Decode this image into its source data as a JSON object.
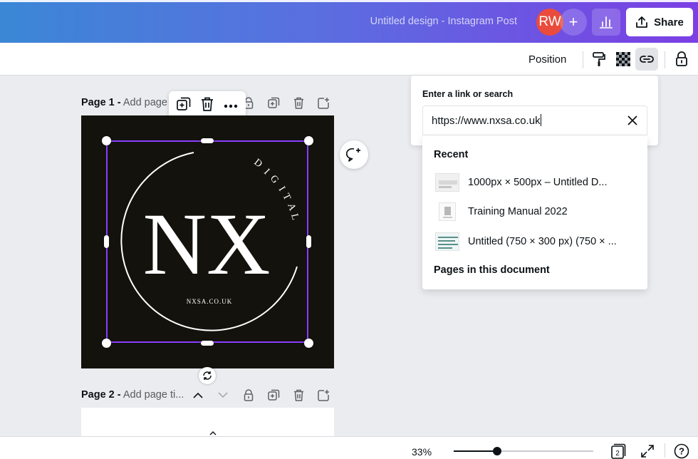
{
  "header": {
    "doc_title": "Untitled design - Instagram Post",
    "avatar_initials": "RW",
    "add_people": "+",
    "share_label": "Share"
  },
  "toolbar": {
    "position_label": "Position"
  },
  "pages": [
    {
      "number_label": "Page 1 -",
      "title_placeholder": "Add page t"
    },
    {
      "number_label": "Page 2 -",
      "title_placeholder": "Add page ti..."
    }
  ],
  "design": {
    "word_digital": "DIGITAL",
    "monogram": "NX",
    "website": "NXSA.CO.UK"
  },
  "link_panel": {
    "label": "Enter a link or search",
    "input_value": "https://www.nxsa.co.uk",
    "recent_heading": "Recent",
    "recent_items": [
      {
        "title": "1000px × 500px – Untitled D..."
      },
      {
        "title": "Training Manual 2022"
      },
      {
        "title": "Untitled (750 × 300 px) (750 × ..."
      }
    ],
    "pages_heading": "Pages in this document"
  },
  "bottom": {
    "zoom_label": "33%",
    "zoom_fraction": 0.31,
    "page_count": "2",
    "help": "?"
  },
  "colors": {
    "accent": "#8b3dff",
    "avatar": "#ea4b3c",
    "canvas": "#13120c"
  }
}
